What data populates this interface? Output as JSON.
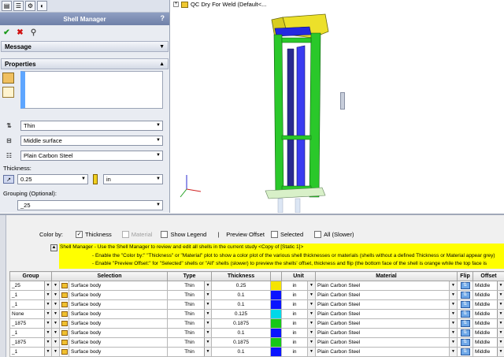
{
  "property_manager": {
    "title": "Shell Manager",
    "help": "?",
    "sections": {
      "message": "Message",
      "properties": "Properties"
    },
    "formulation": "Thin",
    "offset": "Middle surface",
    "material": "Plain Carbon Steel",
    "thickness_label": "Thickness:",
    "thickness_value": "0.25",
    "thickness_unit": "in",
    "grouping_label": "Grouping (Optional):",
    "grouping_value": "_25"
  },
  "graphics": {
    "tree_node": "QC Dry For Weld  (Default<..."
  },
  "shell_manager": {
    "color_by_label": "Color by:",
    "thickness_option": "Thickness",
    "material_option": "Material",
    "show_legend": "Show Legend",
    "separator": "|",
    "preview_offset_label": "Preview Offset",
    "selected_option": "Selected",
    "all_option": "All (Slower)",
    "message_lines": [
      "Shell Manager - Use the Shell Manager to review and edit all shells in the current study <Copy of [Static 1]>",
      "- Enable the \"Color by:\" \"Thickness\" or \"Material\" plot to show a color plot of the various shell thicknesses or materials (shells without a defined Thickness or Material appear grey)",
      "- Enable \"Preview Offset:\" for \"Selected\" shells or \"All\" shells (slower) to preview the shells' offset, thickness and flip (the bottom face of the shell is orange while the top face is"
    ],
    "columns": [
      "Group",
      "Selection",
      "Type",
      "Thickness",
      "",
      "Unit",
      "Material",
      "Flip",
      "Offset"
    ],
    "rows": [
      {
        "group": "_25",
        "selection": "Surface body",
        "type": "Thin",
        "thickness": "0.25",
        "color": "#f5e400",
        "unit": "in",
        "material": "Plain Carbon Steel",
        "offset": "Middle"
      },
      {
        "group": "_1",
        "selection": "Surface body",
        "type": "Thin",
        "thickness": "0.1",
        "color": "#0a14ff",
        "unit": "in",
        "material": "Plain Carbon Steel",
        "offset": "Middle"
      },
      {
        "group": "_1",
        "selection": "Surface body",
        "type": "Thin",
        "thickness": "0.1",
        "color": "#0a14ff",
        "unit": "in",
        "material": "Plain Carbon Steel",
        "offset": "Middle"
      },
      {
        "group": "None",
        "selection": "Surface body",
        "type": "Thin",
        "thickness": "0.125",
        "color": "#00d8e8",
        "unit": "in",
        "material": "Plain Carbon Steel",
        "offset": "Middle"
      },
      {
        "group": "_1875",
        "selection": "Surface body",
        "type": "Thin",
        "thickness": "0.1875",
        "color": "#16c816",
        "unit": "in",
        "material": "Plain Carbon Steel",
        "offset": "Middle"
      },
      {
        "group": "_1",
        "selection": "Surface body",
        "type": "Thin",
        "thickness": "0.1",
        "color": "#0a14ff",
        "unit": "in",
        "material": "Plain Carbon Steel",
        "offset": "Middle"
      },
      {
        "group": "_1875",
        "selection": "Surface body",
        "type": "Thin",
        "thickness": "0.1875",
        "color": "#16c816",
        "unit": "in",
        "material": "Plain Carbon Steel",
        "offset": "Middle"
      },
      {
        "group": "_1",
        "selection": "Surface body",
        "type": "Thin",
        "thickness": "0.1",
        "color": "#0a14ff",
        "unit": "in",
        "material": "Plain Carbon Steel",
        "offset": "Middle"
      }
    ]
  }
}
